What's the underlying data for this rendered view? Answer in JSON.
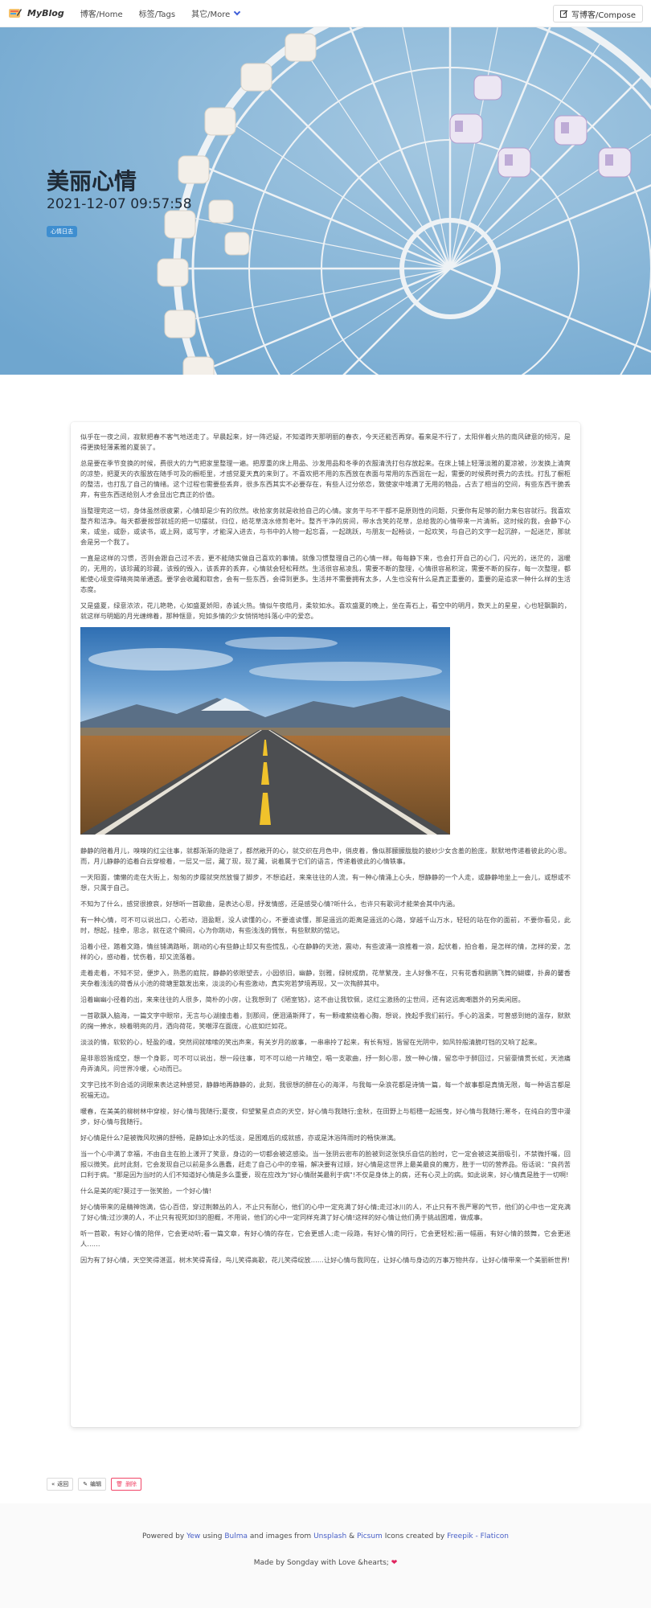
{
  "navbar": {
    "brand": "MyBlog",
    "items": [
      {
        "label": "博客/Home"
      },
      {
        "label": "标签/Tags"
      },
      {
        "label": "其它/More"
      }
    ],
    "compose_label": "写博客/Compose"
  },
  "hero": {
    "title": "美丽心情",
    "date": "2021-12-07 09:57:58",
    "tag": "心情日志"
  },
  "article": {
    "paragraphs_before_image": [
      "似乎在一夜之间，寂默把春不客气地送走了。早晨起来，好一阵迟疑，不知道昨天那明丽的春衣，今天还能否再穿。看来是不行了，太阳伴着火热的南风肆意的倾泻，是得更换轻薄素雅的夏装了。",
      "总是要在季节变换的时候，费很大的力气把家里整理一遍。把厚重的床上用品、沙发用品和冬季的衣服清洗打包存放起来。在床上铺上轻薄淡雅的夏凉被，沙发换上清爽的凉垫，把夏天的衣服放在随手可及的橱柜里，才感觉夏天真的来到了。不喜欢把不用的东西放在表面与常用的东西混在一起，需要的时候费时费力的去找。打乱了橱柜的整洁，也打乱了自己的情绪。这个过程也需要些丢弃，很多东西其实不必要存在，有些人过分依恋，致使家中堆满了无用的物品，占去了相当的空间，有些东西干脆丢弃，有些东西送给别人才会显出它真正的价值。",
      "当整理完这一切，身体虽然很疲累，心情却是少有的欣然。收拾家务就是收拾自己的心情。家务干与不干都不是原则性的问题，只要你有足够的耐力来包容就行。我喜欢整齐和洁净。每天都要按部就班的把一切摆就，归位，给花草浇水修剪老叶。整齐干净的房间，带水含笑的花草，总给我的心情带来一片清新。这时候的我，会静下心来，或坐，或卧，或读书，或上网，或写字，才能深入进去，与书中的人物一起忘喜，一起跳跃，与朋友一起畅谈，一起欢笑，与自己的文字一起沉醉，一起迷茫，那就会是另一个我了。",
      "一直是这样的习惯，否则会跟自己过不去，更不能随实做自己喜欢的事情。就像习惯整理自己的心情一样。每每静下来，也会打开自己的心门，闪光的，迷茫的，温暖的，无用的，该珍藏的珍藏，该毁的毁入，该丢弃的丢弃，心情就会轻松释然。生活很容易凌乱，需要不断的整理，心情很容易积淀，需要不断的探存，每一次整理，都能使心境变得晴亮简单通透。要学会收藏和取舍，会有一些东西，会得到更多。生活并不需要拥有太多，人生也没有什么是真正重要的，重要的是追求一种什么样的生活态度。",
      "又是盛夏，绿意浓浓，花儿艳艳，心如盛夏娇阳，赤诚火热。情似午夜皓月，柔软如水。喜欢盛夏的晚上，坐在青石上，看空中的明月，数天上的星星，心也轻飘飘的，就这样与明媚的月光缠绵着，那种惬意，宛如多情的少女悄悄地抖落心中的爱恋。"
    ],
    "paragraphs_after_image": [
      "静静的陪着月儿，嗅嗅的红尘往事，就都渐渐的隐退了，都然敞开的心，就交织在月色中，俏皮着，像似那朦朦胧胧的披纱少女含羞的脸庞，默默地传递着彼此的心思。而，月儿静静的追着白云穿梭着，一层又一层，藏了现，现了藏，说着属于它们的语言，传递着彼此的心情轶事。",
      "一天阳面，慵懒的走在大街上，匆匆的步履就突然放慢了脚步，不想追赶，来来往往的人流，有一种心情涌上心头，想静静的一个人走，或静静地坐上一会儿，或想或不想，只属于自己。",
      "不知为了什么，感觉很撩哀，好想听一首歌曲，是表达心思，抒发情感，还是感受心情?听什么，也许只有歌词才能荣会其中内涵。",
      "有一种心情，可不可以说出口，心若动，泪盈眶，没人读懂的心，不要谁读懂，那是遥远的距离是遥远的心路，穿越千山万水，轻轻的站在你的面前，不要你看见，此时，想起，挂牵，思念，就在这个瞬间，心为你跳动，有些浅浅的惆怅，有些默默的惦记。",
      "沿着小径，踏着文路，情丝铺满路晰，跳动的心有些静止却又有些慌乱，心在静静的天池，震动，有些波涌一浪推着一浪，起伏着，拍合着，是怎样的情，怎样的爱，怎样的心，感动着，忧伤着，却又流落着。",
      "走着走着，不知不觉，便步入，熟悉的庭院，静静的依眼望去，小园依旧，幽静，别雅，绿树成荫，花草繁茂，主人好像不在，只有花香和鹂鹏飞舞的蝴蝶，扑鼻的馨香夹杂着浅浅的荷香从小池的荷塘里散发出来，淡淡的心有些激动，真实宛若梦境再现，又一次掏醉其中。",
      "沿着幽幽小径着的出，来来往往的人很多，简朴的小房，让我想到了《陋室铭》，这不由让我钦佩，这红尘激扬的尘世间，还有这远离嘲嚣外的另类闲居。",
      "一首歌飘入脑海，一篇文字中眼帘，无言与心湖撞击着，别那间，便泪涌斯拜了，有一颗魂萦绕着心胸，想说，挽起手我们前行。手心的温柔，可曾感到她的温存，默默的掬一捧水，映着明亮的月，洒向荷花，笑嘲浮在面庞，心底如烂如花。",
      "淡淡的情，软软的心，轻盈的魂，突然间就嗦嗦的笑出声来，有关岁月的故事，一串串拎了起来，有长有短，皆留在光阴中，如风铃般清脆叮铛的又响了起来。",
      "是非恩怨皆成空，想一个身影，可不可以说出，想一段往事，可不可以给一片晴空，唱一支歌曲，抒一刻心思，放一种心情，留恋中于醉回过，只留豪情贯长虹，天池痛舟弄清风，问世界冷暖，心动而已。",
      "文字已找不到合适的词眼来表达这种感觉，静静地再静静的，此刻，我很想的醉在心的海洋，与我每一朵浪花都是诗情一篇，每一个故事都是真情无限，每一种语言都是祝福无边。",
      "暖春，在美美的柳树林中穿梭，好心情与我随行;夏夜，仰望繁星点点的天空，好心情与我随行;金秋，在田野上与稻穗一起摇曳，好心情与我随行;寒冬，在纯白的雪中漫步，好心情与我随行。",
      "好心情是什么?是被微风吹拂的舒畅，是静如止水的恬淡，是困难后的成就感，亦或是沐浴阵雨时的畅快淋漓。",
      "当一个心中满了幸福，不由自主在脸上漾开了笑意，身边的一切都会被这感染。当一张阴云密布的脸被到这张快乐自信的脸时，它一定会被这美丽吸引，不禁微扦嘴，回报以微笑。此时此刻，它会发现自己以前是多么愚蠢，赶走了自己心中的幸福，解决要有过顺，好心情是这世界上最美最良的魔方，胜于一切的营养品。俗话说：\"良药苦口利于病。\"那是因为当时的人们不知道好心情是多么重要，现在应改为\"好心情耐美最利于病\"!不仅是身体上的病，还有心灵上的病。如此说来，好心情真是胜于一切啊!",
      "什么是美的呢?莫过于一张笑脸，一个好心情!",
      "好心情带来的是精神饱满，信心百倍，穿过荆棘丛的人，不止只有耐心，他们的心中一定充满了好心情;走过冰川的人，不止只有不畏严寒的气节，他们的心中也一定充满了好心情;过沙漠的人，不止只有视死如归的胆概，不用说，他们的心中一定同样充满了好心情!这样的好心情让他们勇于挑战困难，做成事。",
      "听一首歌，有好心情的陪伴，它会更动听;看一篇文章，有好心情的存在，它会更感人;走一段路，有好心情的同行，它会更轻松;画一幅画，有好心情的鼓舞，它会更迷人……",
      "因为有了好心情，天空笑得湛蓝，树木笑得青绿，鸟儿笑得高歌，花儿笑得绽放……让好心情与我同在，让好心情与身边的万事万物共存，让好心情带来一个美丽新世界!"
    ]
  },
  "actions": {
    "back": "返回",
    "edit": "编辑",
    "delete": "删除"
  },
  "footer": {
    "powered_by": "Powered by",
    "yew": "Yew",
    "using": "using",
    "bulma": "Bulma",
    "images_from": "and images from",
    "unsplash": "Unsplash",
    "amp": "&",
    "picsum": "Picsum",
    "icons_created": "Icons created by",
    "freepik": "Freepik - Flaticon",
    "made_by": "Made by Songday with Love &hearts;"
  }
}
